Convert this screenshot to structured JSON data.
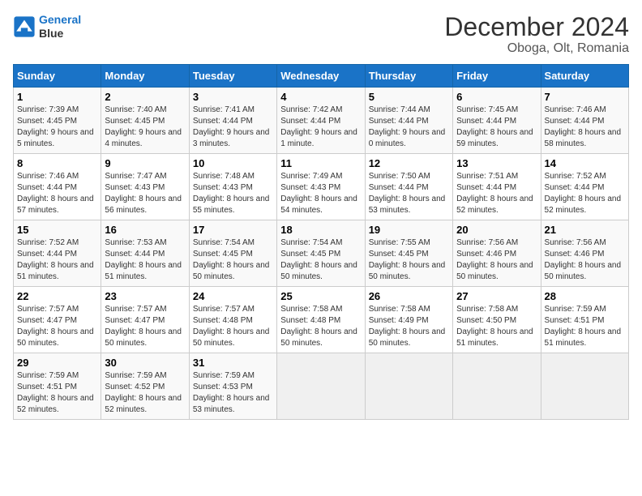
{
  "header": {
    "logo_line1": "General",
    "logo_line2": "Blue",
    "title": "December 2024",
    "subtitle": "Oboga, Olt, Romania"
  },
  "days_of_week": [
    "Sunday",
    "Monday",
    "Tuesday",
    "Wednesday",
    "Thursday",
    "Friday",
    "Saturday"
  ],
  "weeks": [
    [
      {
        "day": "1",
        "info": "Sunrise: 7:39 AM\nSunset: 4:45 PM\nDaylight: 9 hours and 5 minutes."
      },
      {
        "day": "2",
        "info": "Sunrise: 7:40 AM\nSunset: 4:45 PM\nDaylight: 9 hours and 4 minutes."
      },
      {
        "day": "3",
        "info": "Sunrise: 7:41 AM\nSunset: 4:44 PM\nDaylight: 9 hours and 3 minutes."
      },
      {
        "day": "4",
        "info": "Sunrise: 7:42 AM\nSunset: 4:44 PM\nDaylight: 9 hours and 1 minute."
      },
      {
        "day": "5",
        "info": "Sunrise: 7:44 AM\nSunset: 4:44 PM\nDaylight: 9 hours and 0 minutes."
      },
      {
        "day": "6",
        "info": "Sunrise: 7:45 AM\nSunset: 4:44 PM\nDaylight: 8 hours and 59 minutes."
      },
      {
        "day": "7",
        "info": "Sunrise: 7:46 AM\nSunset: 4:44 PM\nDaylight: 8 hours and 58 minutes."
      }
    ],
    [
      {
        "day": "8",
        "info": "Sunrise: 7:46 AM\nSunset: 4:44 PM\nDaylight: 8 hours and 57 minutes."
      },
      {
        "day": "9",
        "info": "Sunrise: 7:47 AM\nSunset: 4:43 PM\nDaylight: 8 hours and 56 minutes."
      },
      {
        "day": "10",
        "info": "Sunrise: 7:48 AM\nSunset: 4:43 PM\nDaylight: 8 hours and 55 minutes."
      },
      {
        "day": "11",
        "info": "Sunrise: 7:49 AM\nSunset: 4:43 PM\nDaylight: 8 hours and 54 minutes."
      },
      {
        "day": "12",
        "info": "Sunrise: 7:50 AM\nSunset: 4:44 PM\nDaylight: 8 hours and 53 minutes."
      },
      {
        "day": "13",
        "info": "Sunrise: 7:51 AM\nSunset: 4:44 PM\nDaylight: 8 hours and 52 minutes."
      },
      {
        "day": "14",
        "info": "Sunrise: 7:52 AM\nSunset: 4:44 PM\nDaylight: 8 hours and 52 minutes."
      }
    ],
    [
      {
        "day": "15",
        "info": "Sunrise: 7:52 AM\nSunset: 4:44 PM\nDaylight: 8 hours and 51 minutes."
      },
      {
        "day": "16",
        "info": "Sunrise: 7:53 AM\nSunset: 4:44 PM\nDaylight: 8 hours and 51 minutes."
      },
      {
        "day": "17",
        "info": "Sunrise: 7:54 AM\nSunset: 4:45 PM\nDaylight: 8 hours and 50 minutes."
      },
      {
        "day": "18",
        "info": "Sunrise: 7:54 AM\nSunset: 4:45 PM\nDaylight: 8 hours and 50 minutes."
      },
      {
        "day": "19",
        "info": "Sunrise: 7:55 AM\nSunset: 4:45 PM\nDaylight: 8 hours and 50 minutes."
      },
      {
        "day": "20",
        "info": "Sunrise: 7:56 AM\nSunset: 4:46 PM\nDaylight: 8 hours and 50 minutes."
      },
      {
        "day": "21",
        "info": "Sunrise: 7:56 AM\nSunset: 4:46 PM\nDaylight: 8 hours and 50 minutes."
      }
    ],
    [
      {
        "day": "22",
        "info": "Sunrise: 7:57 AM\nSunset: 4:47 PM\nDaylight: 8 hours and 50 minutes."
      },
      {
        "day": "23",
        "info": "Sunrise: 7:57 AM\nSunset: 4:47 PM\nDaylight: 8 hours and 50 minutes."
      },
      {
        "day": "24",
        "info": "Sunrise: 7:57 AM\nSunset: 4:48 PM\nDaylight: 8 hours and 50 minutes."
      },
      {
        "day": "25",
        "info": "Sunrise: 7:58 AM\nSunset: 4:48 PM\nDaylight: 8 hours and 50 minutes."
      },
      {
        "day": "26",
        "info": "Sunrise: 7:58 AM\nSunset: 4:49 PM\nDaylight: 8 hours and 50 minutes."
      },
      {
        "day": "27",
        "info": "Sunrise: 7:58 AM\nSunset: 4:50 PM\nDaylight: 8 hours and 51 minutes."
      },
      {
        "day": "28",
        "info": "Sunrise: 7:59 AM\nSunset: 4:51 PM\nDaylight: 8 hours and 51 minutes."
      }
    ],
    [
      {
        "day": "29",
        "info": "Sunrise: 7:59 AM\nSunset: 4:51 PM\nDaylight: 8 hours and 52 minutes."
      },
      {
        "day": "30",
        "info": "Sunrise: 7:59 AM\nSunset: 4:52 PM\nDaylight: 8 hours and 52 minutes."
      },
      {
        "day": "31",
        "info": "Sunrise: 7:59 AM\nSunset: 4:53 PM\nDaylight: 8 hours and 53 minutes."
      },
      null,
      null,
      null,
      null
    ]
  ]
}
